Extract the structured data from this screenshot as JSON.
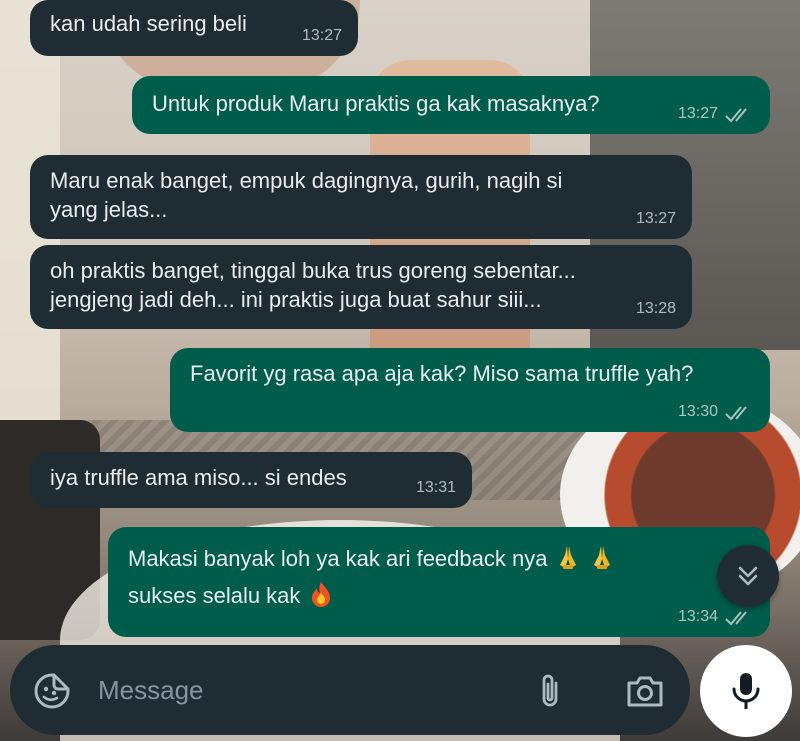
{
  "messages": [
    {
      "dir": "in",
      "text": "kan udah sering beli",
      "time": "13:27"
    },
    {
      "dir": "out",
      "text": "Untuk produk Maru praktis ga kak masaknya?",
      "time": "13:27"
    },
    {
      "dir": "in",
      "text": "Maru enak banget, empuk dagingnya, gurih, nagih si\nyang jelas...",
      "time": "13:27"
    },
    {
      "dir": "in",
      "text": "oh praktis banget, tinggal buka trus goreng sebentar...\njengjeng jadi deh... ini praktis juga buat sahur siii...",
      "time": "13:28"
    },
    {
      "dir": "out",
      "text": "Favorit yg rasa apa aja kak? Miso sama truffle yah?",
      "time": "13:30"
    },
    {
      "dir": "in",
      "text": "iya truffle ama miso... si endes",
      "time": "13:31"
    },
    {
      "dir": "out",
      "line1": "Makasi banyak loh ya kak ari feedback nya",
      "line2": "sukses selalu kak",
      "emojis": [
        "folded-hands",
        "folded-hands",
        "fire"
      ],
      "time": "13:34"
    }
  ],
  "composer": {
    "placeholder": "Message"
  },
  "icons": {
    "read_receipt": "double-check-icon",
    "scroll_down": "double-chevron-down-icon",
    "sticker": "sticker-icon",
    "attach": "paperclip-icon",
    "camera": "camera-icon",
    "mic": "microphone-icon"
  },
  "colors": {
    "incoming_bubble": "#1f2c34",
    "outgoing_bubble": "#005c4b",
    "text": "#e9edef",
    "meta": "#8696a0"
  }
}
